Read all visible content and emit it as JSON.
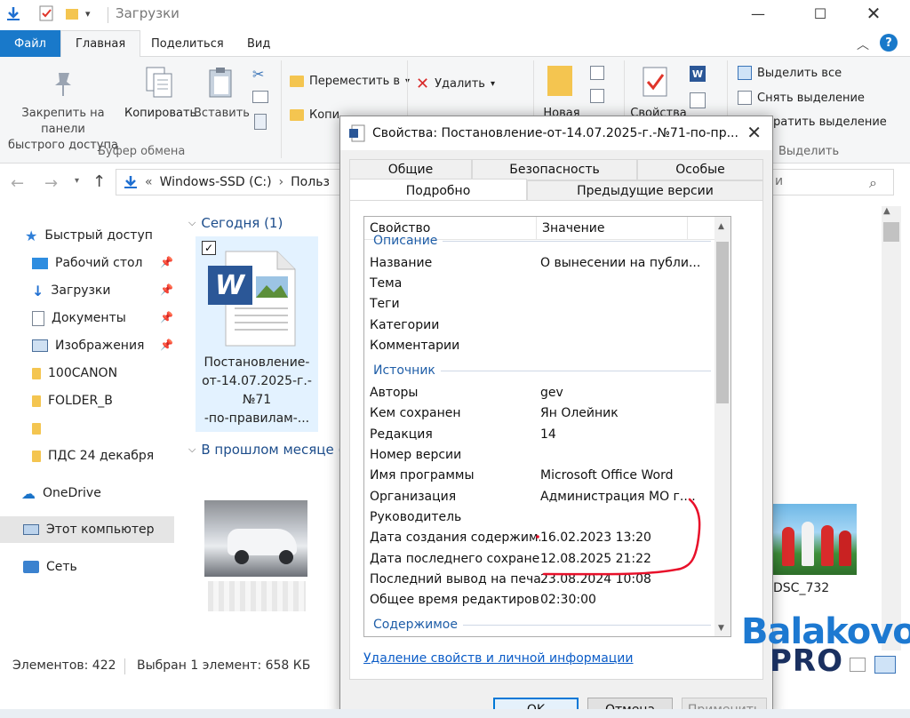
{
  "window": {
    "title": "Загрузки"
  },
  "ribbon": {
    "tabs": [
      "Файл",
      "Главная",
      "Поделиться",
      "Вид"
    ],
    "pin_label_1": "Закрепить на панели",
    "pin_label_2": "быстрого доступа",
    "copy_label": "Копировать",
    "paste_label": "Вставить",
    "clipboard_group": "Буфер обмена",
    "move_to_label": "Переместить в",
    "copy_to_label": "Копи",
    "delete_label": "Удалить",
    "new_label": "Новая",
    "properties_label": "Свойства",
    "select_all_label": "Выделить все",
    "deselect_label": "Снять выделение",
    "invert_label": "ратить выделение",
    "select_group": "Выделить"
  },
  "address": {
    "location": "Windows-SSD (C:)",
    "next": "Польз",
    "search_partial": "и"
  },
  "nav": {
    "quick_access": "Быстрый доступ",
    "items": [
      {
        "label": "Рабочий стол",
        "pinned": true
      },
      {
        "label": "Загрузки",
        "pinned": true
      },
      {
        "label": "Документы",
        "pinned": true
      },
      {
        "label": "Изображения",
        "pinned": true
      },
      {
        "label": "100CANON",
        "pinned": false
      },
      {
        "label": "FOLDER_B",
        "pinned": false
      },
      {
        "label": "",
        "pinned": false
      },
      {
        "label": "ПДС 24 декабря",
        "pinned": false
      }
    ],
    "onedrive": "OneDrive",
    "this_pc": "Этот компьютер",
    "network": "Сеть"
  },
  "content": {
    "group_today": "Сегодня (1)",
    "group_last_month": "В прошлом месяце (8",
    "file_name_lines": [
      "Постановление-",
      "от-14.07.2025-г.-",
      "№71",
      "-по-правилам-..."
    ],
    "photo_right_label": "DSC_732"
  },
  "status": {
    "items_count": "Элементов: 422",
    "selected": "Выбран 1 элемент: 658 КБ"
  },
  "dialog": {
    "title": "Свойства: Постановление-от-14.07.2025-г.-№71-по-пр...",
    "tabs_row1": [
      "Общие",
      "Безопасность",
      "Особые"
    ],
    "tabs_row2": [
      "Подробно",
      "Предыдущие версии"
    ],
    "col_property": "Свойство",
    "col_value": "Значение",
    "section_description": "Описание",
    "description_rows": [
      {
        "name": "Название",
        "value": "О вынесении на публи..."
      },
      {
        "name": "Тема",
        "value": ""
      },
      {
        "name": "Теги",
        "value": ""
      },
      {
        "name": "Категории",
        "value": ""
      },
      {
        "name": "Комментарии",
        "value": ""
      }
    ],
    "section_source": "Источник",
    "source_rows": [
      {
        "name": "Авторы",
        "value": "gev"
      },
      {
        "name": "Кем сохранен",
        "value": "Ян Олейник"
      },
      {
        "name": "Редакция",
        "value": "14"
      },
      {
        "name": "Номер версии",
        "value": ""
      },
      {
        "name": "Имя программы",
        "value": "Microsoft Office Word"
      },
      {
        "name": "Организация",
        "value": "Администрация МО г...."
      },
      {
        "name": "Руководитель",
        "value": ""
      },
      {
        "name": "Дата создания содержим...",
        "value": "16.02.2023 13:20"
      },
      {
        "name": "Дата последнего сохране...",
        "value": "12.08.2025 21:22"
      },
      {
        "name": "Последний вывод на печа...",
        "value": "23.08.2024 10:08"
      },
      {
        "name": "Общее время редактиров...",
        "value": "02:30:00"
      }
    ],
    "section_content": "Содержимое",
    "remove_link": "Удаление свойств и личной информации",
    "ok": "OK",
    "cancel": "Отмена",
    "apply": "Применить"
  },
  "watermark": {
    "line1": "Balakovo",
    "line2": "PRO"
  },
  "colors": {
    "accent": "#1979ca",
    "link": "#0b5cc7",
    "section": "#1f5ea8",
    "annotation_red": "#e8102a",
    "watermark_blue": "#1d79d1",
    "watermark_dark": "#1a3060"
  }
}
